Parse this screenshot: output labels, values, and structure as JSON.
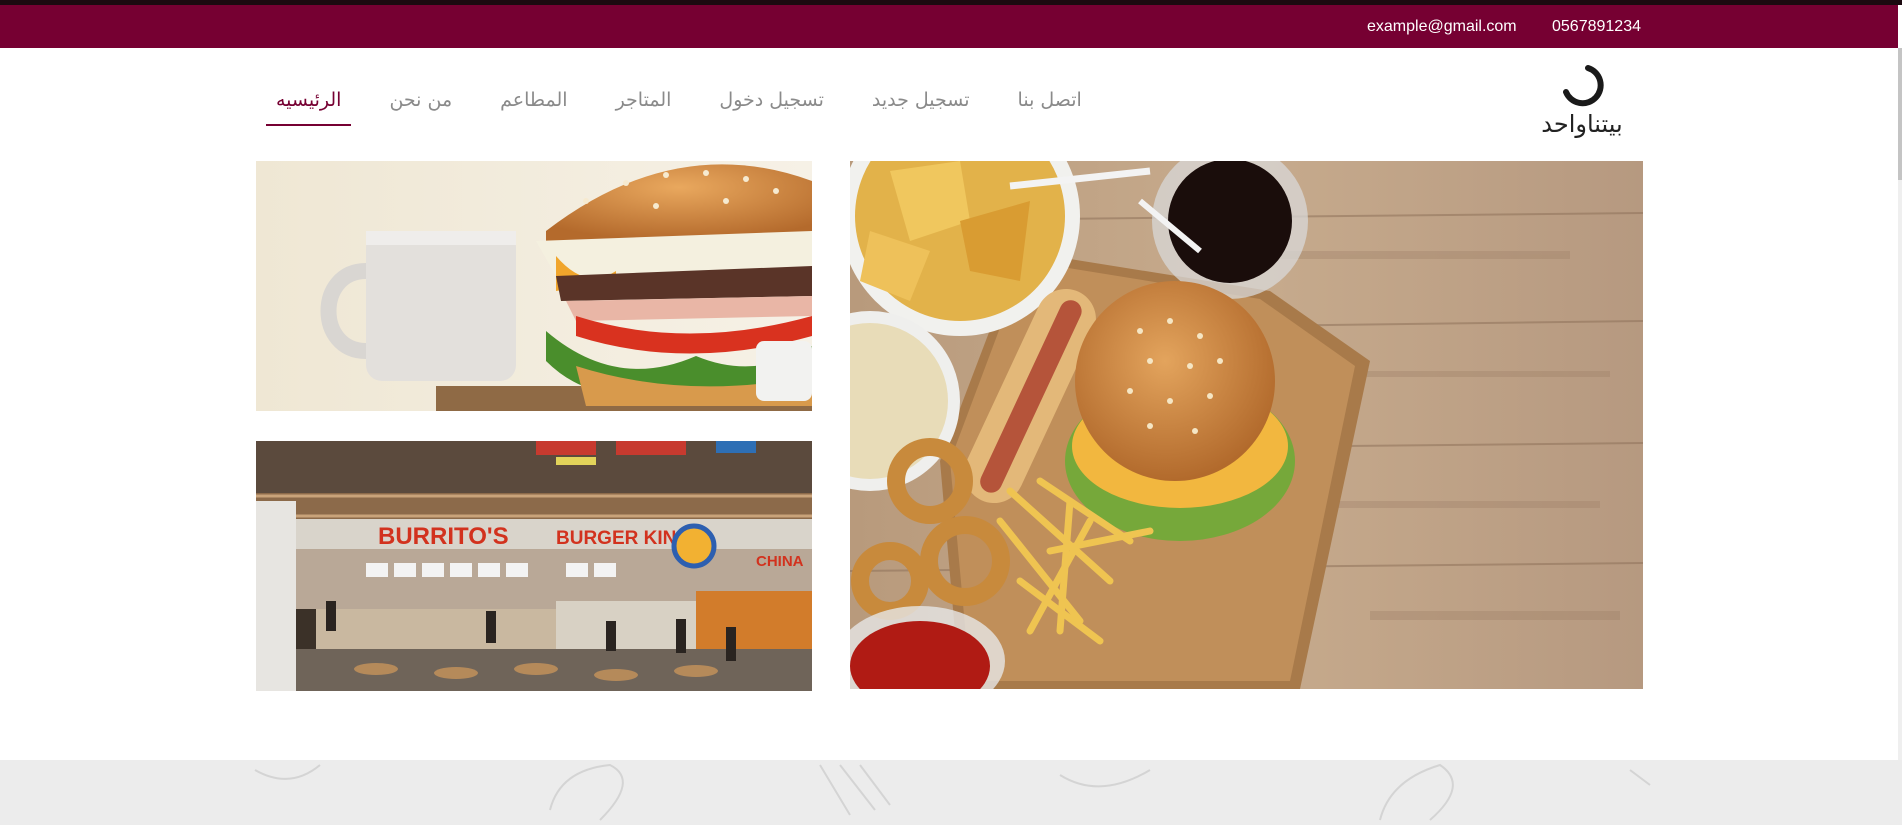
{
  "colors": {
    "brand": "#760032",
    "footer_band": "#ececec"
  },
  "topbar": {
    "phone": "0567891234",
    "email": "example@gmail.com"
  },
  "logo": {
    "text": "بيتناواحد",
    "icon": "circle-arc-icon"
  },
  "nav": {
    "items": [
      {
        "label": "الرئيسيه",
        "active": true
      },
      {
        "label": "من نحن",
        "active": false
      },
      {
        "label": "المطاعم",
        "active": false
      },
      {
        "label": "المتاجر",
        "active": false
      },
      {
        "label": "تسجيل دخول",
        "active": false
      },
      {
        "label": "تسجيل جديد",
        "active": false
      },
      {
        "label": "اتصل بنا",
        "active": false
      }
    ]
  },
  "images": {
    "hero": {
      "icon": "fast-food-board-image"
    },
    "burger": {
      "icon": "burger-and-cup-image"
    },
    "food_court": {
      "icon": "food-court-image",
      "signs": [
        "BURRITO'S",
        "BURGER KING",
        "CHINA"
      ]
    }
  }
}
